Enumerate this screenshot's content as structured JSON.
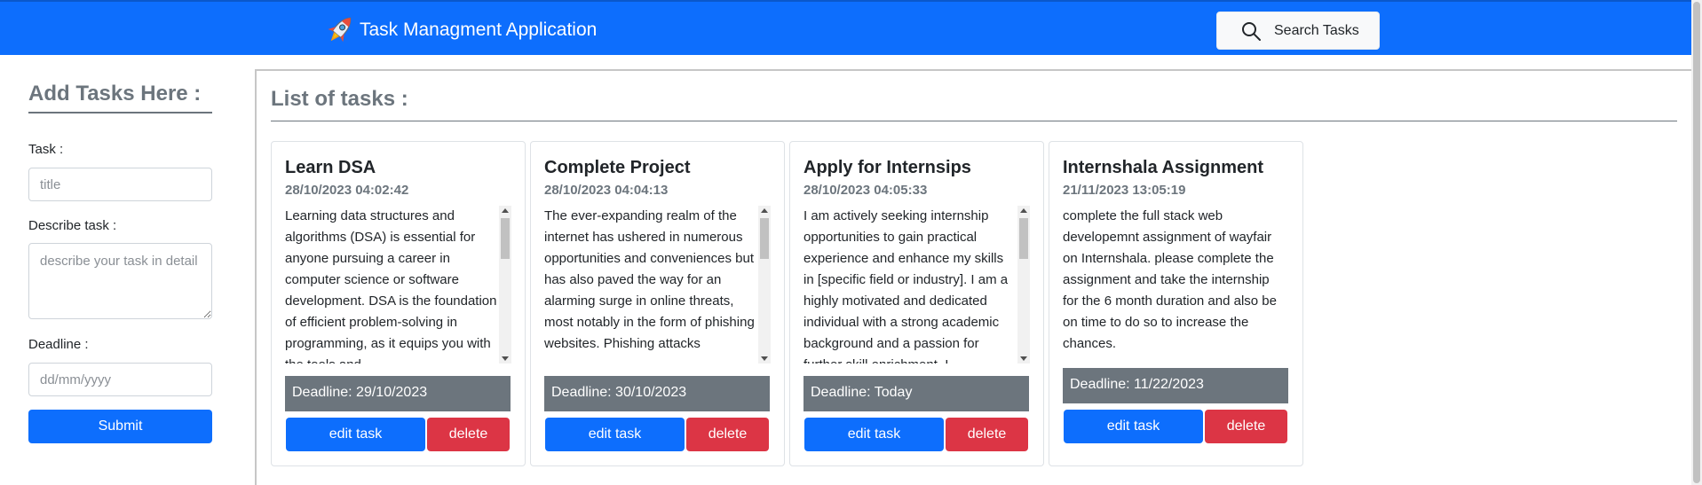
{
  "navbar": {
    "brand_icon": "rocket-icon",
    "brand_title": "Task Managment Application",
    "search_label": "Search Tasks",
    "search_icon": "search-icon",
    "color": "#0d6efd"
  },
  "form": {
    "title": "Add Tasks Here :",
    "task_label": "Task :",
    "task_placeholder": "title",
    "desc_label": "Describe task :",
    "desc_placeholder": "describe your task in detail",
    "deadline_label": "Deadline :",
    "deadline_placeholder": "dd/mm/yyyy",
    "submit_label": "Submit"
  },
  "list": {
    "title": "List of tasks :",
    "tasks": [
      {
        "title": "Learn DSA",
        "date": "28/10/2023 04:02:42",
        "description": "Learning data structures and algorithms (DSA) is essential for anyone pursuing a career in computer science or software development. DSA is the foundation of efficient problem-solving in programming, as it equips you with the tools and",
        "deadline": "Deadline: 29/10/2023",
        "edit_label": "edit task",
        "delete_label": "delete"
      },
      {
        "title": "Complete Project",
        "date": "28/10/2023 04:04:13",
        "description": "The ever-expanding realm of the internet has ushered in numerous opportunities and conveniences but has also paved the way for an alarming surge in online threats, most notably in the form of phishing websites. Phishing attacks",
        "deadline": "Deadline: 30/10/2023",
        "edit_label": "edit task",
        "delete_label": "delete"
      },
      {
        "title": "Apply for Internsips",
        "date": "28/10/2023 04:05:33",
        "description": "I am actively seeking internship opportunities to gain practical experience and enhance my skills in [specific field or industry]. I am a highly motivated and dedicated individual with a strong academic background and a passion for further skill enrichment. I",
        "deadline": "Deadline: Today",
        "edit_label": "edit task",
        "delete_label": "delete"
      },
      {
        "title": "Internshala Assignment",
        "date": "21/11/2023 13:05:19",
        "description": "complete the full stack web developemnt assignment of wayfair on Internshala. please complete the assignment and take the internship for the 6 month duration and also be on time to do so to increase the chances.",
        "deadline": "Deadline: 11/22/2023",
        "edit_label": "edit task",
        "delete_label": "delete"
      }
    ]
  },
  "colors": {
    "primary": "#0d6efd",
    "danger": "#dc3545",
    "secondary": "#6c757d"
  }
}
